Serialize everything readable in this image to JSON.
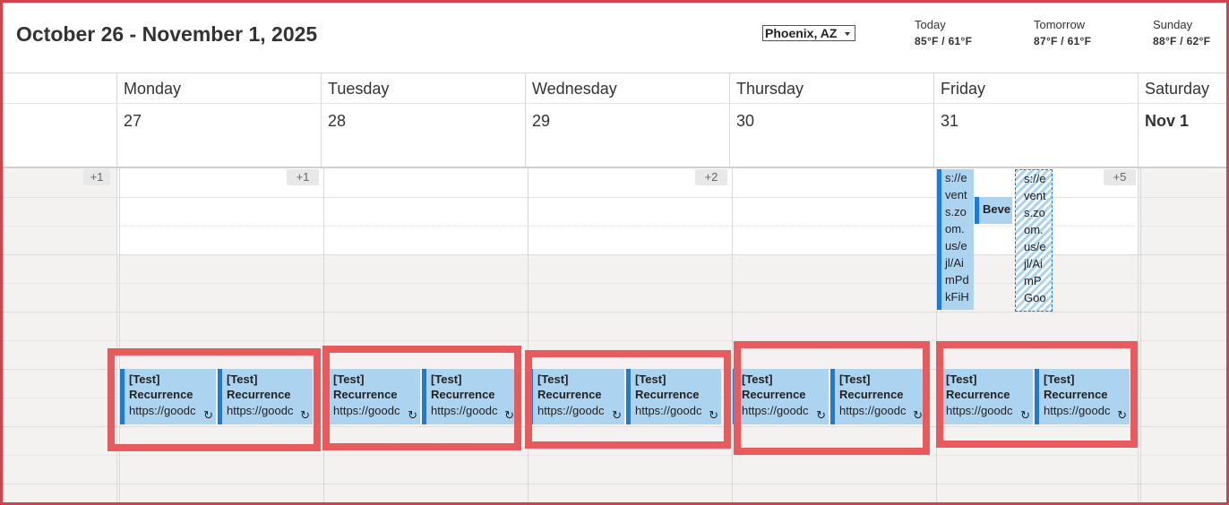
{
  "header": {
    "range_title": "October 26 - November 1, 2025",
    "location": "Phoenix, AZ",
    "weather": [
      {
        "day": "Today",
        "temp": "85°F / 61°F"
      },
      {
        "day": "Tomorrow",
        "temp": "87°F / 61°F"
      },
      {
        "day": "Sunday",
        "temp": "88°F / 62°F"
      }
    ]
  },
  "days": [
    {
      "name": "Monday",
      "number": "27"
    },
    {
      "name": "Tuesday",
      "number": "28"
    },
    {
      "name": "Wednesday",
      "number": "29"
    },
    {
      "name": "Thursday",
      "number": "30"
    },
    {
      "name": "Friday",
      "number": "31"
    },
    {
      "name": "Saturday",
      "number": "Nov 1"
    }
  ],
  "more_badges": [
    "+1",
    "+1",
    "+2",
    "+5"
  ],
  "recurring_event": {
    "title_line1": "[Test]",
    "title_line2": "Recurrence",
    "url": "https://goodc",
    "recur_icon": "↻"
  },
  "friday_events": {
    "event_a_lines": [
      "s://e",
      "vent",
      "s.zo",
      "om.",
      "us/e",
      "jl/Ai",
      "mPd",
      "kFiH"
    ],
    "event_b_lines": [
      "s://e",
      "vent",
      "s.zo",
      "om.",
      "us/e",
      "jl/Ai",
      "mP",
      "Goo"
    ],
    "event_c_title": "Beve"
  },
  "colors": {
    "highlight": "#e85a5c",
    "event_fill": "#acd4f1",
    "event_accent": "#1b7bd6",
    "frame": "#d0434a"
  }
}
